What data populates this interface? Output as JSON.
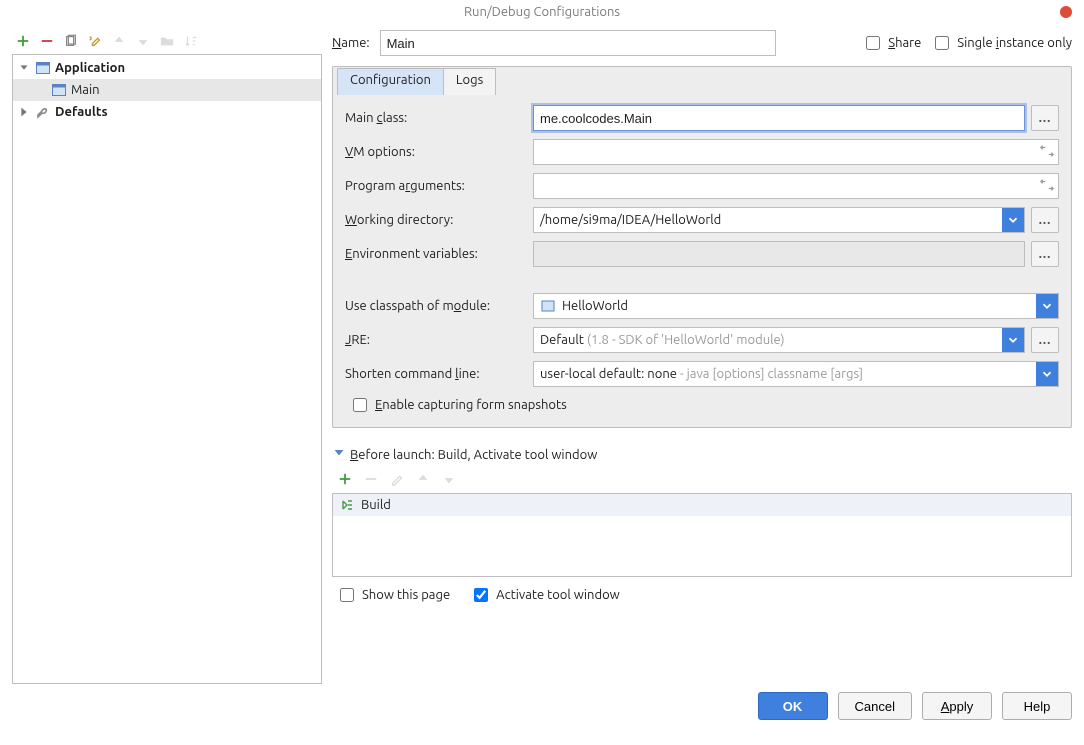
{
  "title": "Run/Debug Configurations",
  "left_toolbar": {
    "add": "add",
    "remove": "remove",
    "copy": "copy",
    "settings": "settings",
    "up": "up",
    "down": "down",
    "folder": "folder",
    "sort": "sort"
  },
  "tree": {
    "app_label": "Application",
    "app_child": "Main",
    "defaults_label": "Defaults"
  },
  "name_label": "Name:",
  "name_value": "Main",
  "share_label": "Share",
  "single_instance_label": "Single instance only",
  "tabs": {
    "config": "Configuration",
    "logs": "Logs"
  },
  "fields": {
    "main_class_label": "Main class:",
    "main_class_value": "me.coolcodes.Main",
    "vm_label": "VM options:",
    "vm_value": "",
    "args_label": "Program arguments:",
    "args_value": "",
    "wd_label": "Working directory:",
    "wd_value": "/home/si9ma/IDEA/HelloWorld",
    "env_label": "Environment variables:",
    "env_value": "",
    "cp_label": "Use classpath of module:",
    "cp_value": "HelloWorld",
    "jre_label": "JRE:",
    "jre_value": "Default",
    "jre_hint": "(1.8 - SDK of 'HelloWorld' module)",
    "shorten_label": "Shorten command line:",
    "shorten_value": "user-local default: none",
    "shorten_hint": "- java [options] classname [args]",
    "snapshot_label": "Enable capturing form snapshots"
  },
  "before_launch": {
    "header": "Before launch: Build, Activate tool window",
    "item": "Build",
    "show_page": "Show this page",
    "activate": "Activate tool window"
  },
  "buttons": {
    "ok": "OK",
    "cancel": "Cancel",
    "apply": "Apply",
    "help": "Help"
  }
}
